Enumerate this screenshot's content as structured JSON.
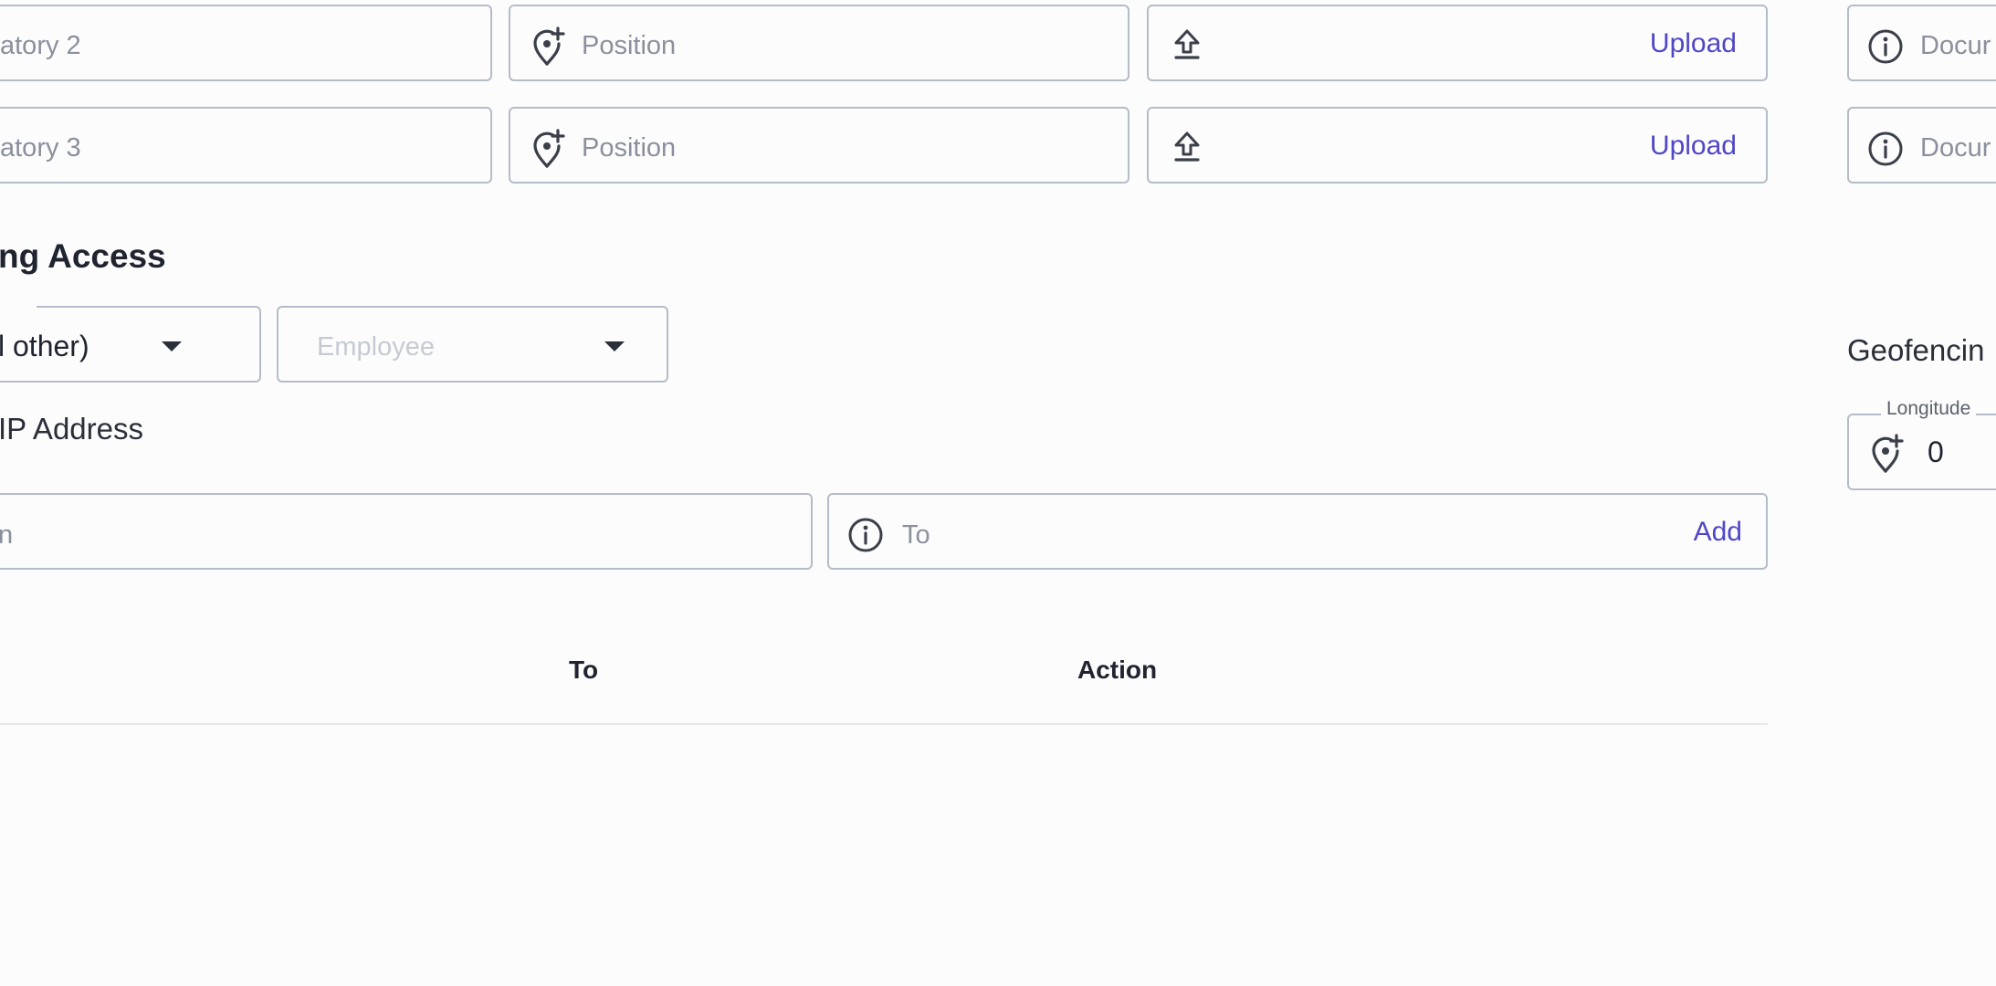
{
  "signatories": [
    {
      "name_placeholder": "atory 2",
      "position_placeholder": "Position",
      "upload_label": "Upload",
      "doc_placeholder": "Docur"
    },
    {
      "name_placeholder": "atory 3",
      "position_placeholder": "Position",
      "upload_label": "Upload",
      "doc_placeholder": "Docur"
    }
  ],
  "access": {
    "title": "ng Access",
    "select_left_value": "l other)",
    "select_employee_placeholder": "Employee"
  },
  "ip": {
    "title": "IP Address",
    "from_placeholder": "n",
    "to_placeholder": "To",
    "add_label": "Add",
    "table_headers": [
      "To",
      "Action"
    ]
  },
  "geofencing": {
    "title": "Geofencin",
    "longitude_label": "Longitude",
    "longitude_value": "0"
  },
  "colors": {
    "accent": "#4f46c8",
    "border": "#b5bcc9",
    "placeholder": "#8a909c"
  },
  "icons": {
    "position": "map-pin-plus-icon",
    "upload": "upload-icon",
    "info": "info-icon",
    "dropdown": "caret-down-icon"
  }
}
